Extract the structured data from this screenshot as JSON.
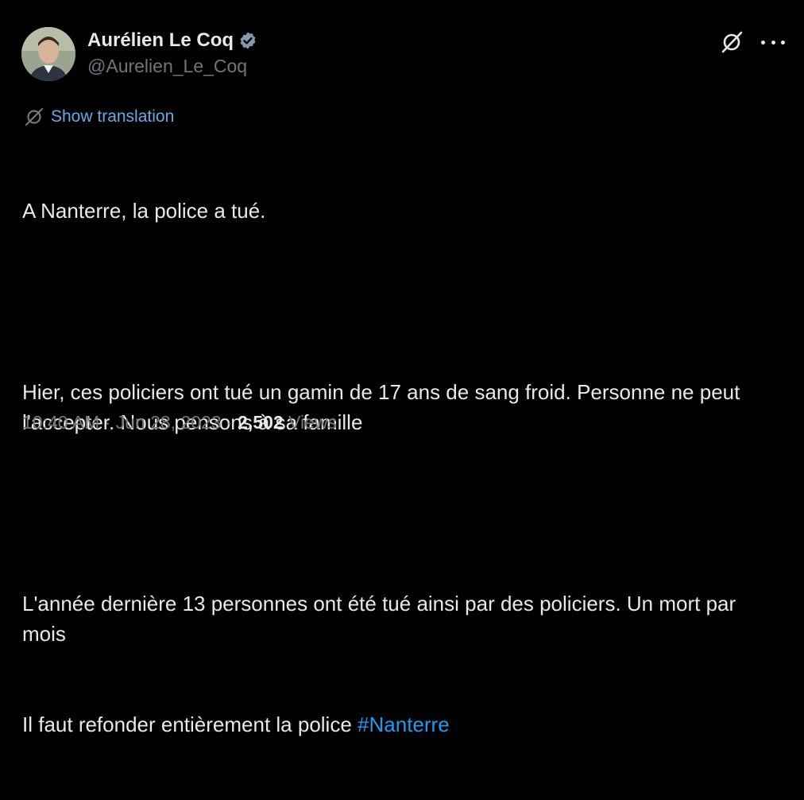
{
  "author": {
    "display_name": "Aurélien Le Coq",
    "handle": "@Aurelien_Le_Coq",
    "verified_icon": "verified-badge-icon"
  },
  "actions": {
    "grok_icon": "grok-icon",
    "more_icon": "more-icon"
  },
  "translate": {
    "label": "Show translation",
    "icon": "translate-icon"
  },
  "tweet": {
    "line1": "A Nanterre, la police a tué.",
    "line2": "Hier, ces policiers ont tué un gamin de 17 ans de sang froid. Personne ne peut l'accepter. Nous pensons à sa famille",
    "line3": "L'année dernière 13 personnes ont été tué ainsi par des policiers. Un mort par mois",
    "line4_text": "Il faut refonder entièrement la police ",
    "hashtag": "#Nanterre"
  },
  "meta": {
    "time": "10:40 AM",
    "separator": "·",
    "date": "Jun 28, 2023",
    "views_count": "2,502",
    "views_label": "Views"
  },
  "colors": {
    "background": "#000000",
    "text": "#e7e9ea",
    "muted": "#71767b",
    "link": "#1d9bf0",
    "verified": "#829aab"
  }
}
